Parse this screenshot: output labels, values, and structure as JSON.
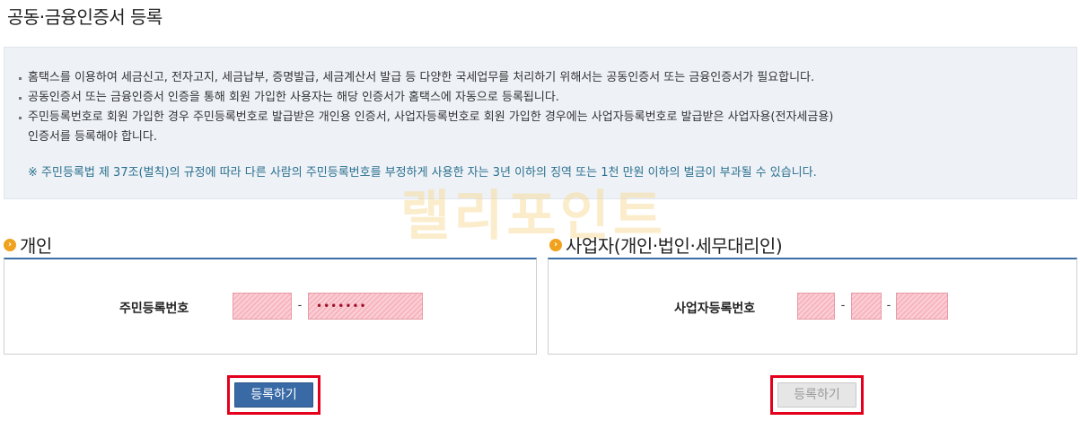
{
  "page_title": "공동·금융인증서 등록",
  "notice": {
    "items": [
      "홈택스를 이용하여 세금신고, 전자고지, 세금납부, 증명발급, 세금계산서 발급 등 다양한 국세업무를 처리하기 위해서는 공동인증서 또는 금융인증서가 필요합니다.",
      "공동인증서 또는 금융인증서 인증을 통해 회원 가입한 사용자는 해당 인증서가 홈택스에 자동으로 등록됩니다.",
      "주민등록번호로 회원 가입한 경우 주민등록번호로 발급받은 개인용 인증서, 사업자등록번호로 회원 가입한 경우에는 사업자등록번호로 발급받은 사업자용(전자세금용)",
      "인증서를 등록해야 합니다."
    ],
    "warning": "※ 주민등록법 제 37조(벌칙)의 규정에 따라 다른 사람의 주민등록번호를 부정하게 사용한 자는 3년 이하의 징역 또는 1천 만원 이하의 벌금이 부과될 수 있습니다."
  },
  "watermark": "랠리포인트",
  "individual": {
    "heading": "개인",
    "field_label": "주민등록번호",
    "separator": "-",
    "masked_value": "•••••••",
    "register_button": "등록하기"
  },
  "business": {
    "heading": "사업자(개인·법인·세무대리인)",
    "field_label": "사업자등록번호",
    "separator1": "-",
    "separator2": "-",
    "register_button": "등록하기"
  },
  "colors": {
    "primary_button": "#3a6aa6",
    "highlight_border": "#e4001c",
    "section_accent": "#3d6ea8",
    "bullet_icon": "#f0a21e"
  }
}
